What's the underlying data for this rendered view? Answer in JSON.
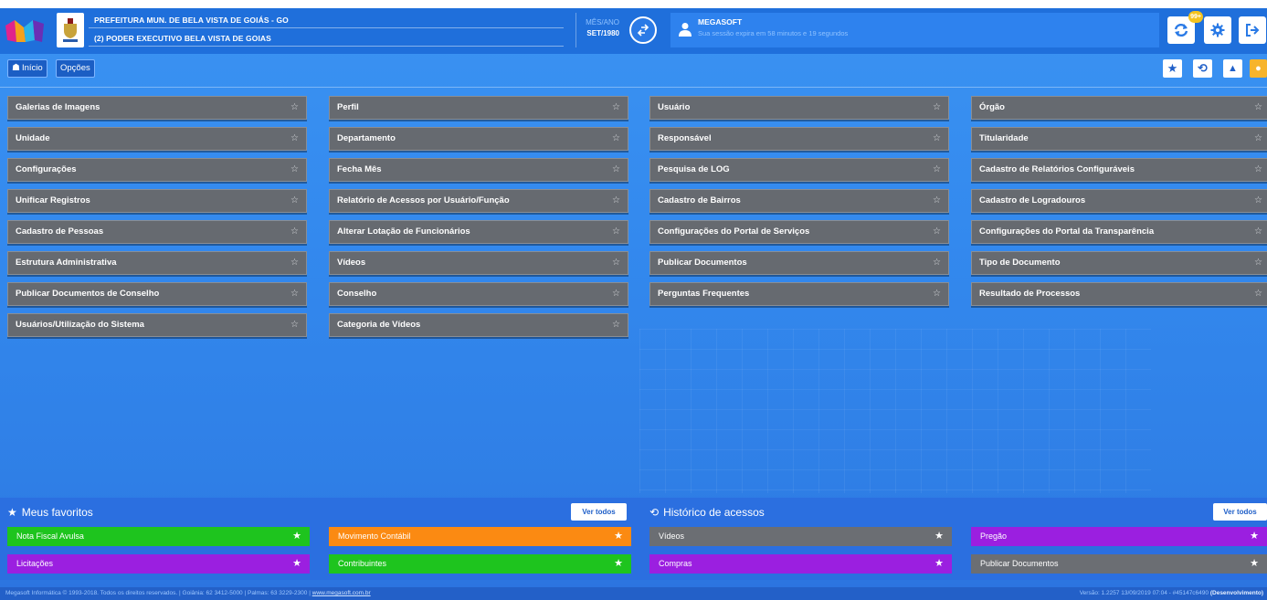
{
  "header": {
    "org_name": "PREFEITURA MUN. DE BELA VISTA DE GOIÁS - GO",
    "org_unit": "(2) PODER EXECUTIVO BELA VISTA DE GOIAS",
    "period_label": "MÊS/ANO",
    "period_value": "SET/1980",
    "user_name": "MEGASOFT",
    "session_text": "Sua sessão expira em 58 minutos e 19 segundos",
    "notification_badge": "99+"
  },
  "nav": {
    "home_label": "Início",
    "options_label": "Opções"
  },
  "menu": {
    "col1": [
      "Galerias de Imagens",
      "Unidade",
      "Configurações",
      "Unificar Registros",
      "Cadastro de Pessoas",
      "Estrutura Administrativa",
      "Publicar Documentos de Conselho",
      "Usuários/Utilização do Sistema"
    ],
    "col2": [
      "Perfil",
      "Departamento",
      "Fecha Mês",
      "Relatório de Acessos por Usuário/Função",
      "Alterar Lotação de Funcionários",
      "Vídeos",
      "Conselho",
      "Categoria de Vídeos"
    ],
    "col3": [
      "Usuário",
      "Responsável",
      "Pesquisa de LOG",
      "Cadastro de Bairros",
      "Configurações do Portal de Serviços",
      "Publicar Documentos",
      "Perguntas Frequentes"
    ],
    "col4": [
      "Órgão",
      "Titularidade",
      "Cadastro de Relatórios Configuráveis",
      "Cadastro de Logradouros",
      "Configurações do Portal da Transparência",
      "Tipo de Documento",
      "Resultado de Processos"
    ]
  },
  "favorites": {
    "title": "Meus favoritos",
    "view_all": "Ver todos",
    "items": [
      {
        "label": "Nota Fiscal Avulsa",
        "color": "#1ec41e"
      },
      {
        "label": "Movimento Contábil",
        "color": "#fb8a12"
      },
      {
        "label": "Licitações",
        "color": "#9b1fe0"
      },
      {
        "label": "Contribuintes",
        "color": "#1ec41e"
      }
    ]
  },
  "history": {
    "title": "Histórico de acessos",
    "view_all": "Ver todos",
    "items": [
      {
        "label": "Vídeos",
        "color": "#6b6e73"
      },
      {
        "label": "Pregão",
        "color": "#9b1fe0"
      },
      {
        "label": "Compras",
        "color": "#9b1fe0"
      },
      {
        "label": "Publicar Documentos",
        "color": "#6b6e73"
      }
    ]
  },
  "footer": {
    "copyright": "Megasoft Informática © 1993-2018. Todos os direitos reservados.",
    "goiania": "Goiânia: 62 3412-5000",
    "palmas": "Palmas: 63 3229-2300",
    "site": "www.megasoft.com.br",
    "version": "Versão: 1.2257 13/09/2019 07:04 - #45147c6490",
    "env": "(Desenvolvimento)"
  }
}
